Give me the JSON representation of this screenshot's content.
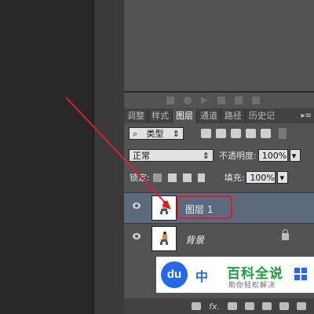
{
  "panel": {
    "tabs": [
      {
        "label": "调整"
      },
      {
        "label": "样式"
      },
      {
        "label": "图层",
        "active": true
      },
      {
        "label": "通道"
      },
      {
        "label": "路径"
      },
      {
        "label": "历史记"
      }
    ],
    "menu_icon": "panel-menu-icon",
    "filter": {
      "search_glyph": "⌕",
      "value": "类型",
      "arrow": "⇕"
    },
    "blend_mode": {
      "value": "正常",
      "arrow": "⇕"
    },
    "opacity": {
      "label": "不透明度:",
      "value": "100%",
      "arrow": "▾"
    },
    "lock": {
      "label": "锁定:"
    },
    "fill": {
      "label": "填充:",
      "value": "100%",
      "arrow": "▾"
    },
    "layers": [
      {
        "name": "图层 1",
        "selected": true
      },
      {
        "name": "背景",
        "locked": true
      }
    ],
    "bottom_fx": "fx."
  },
  "watermark": {
    "logo_text": "du",
    "cn": "中",
    "title": "百科全说",
    "subtitle": "助你轻松解决"
  },
  "colors": {
    "accent_red": "#d9202a",
    "selected_layer": "#5b6a7d",
    "panel_bg": "#535353"
  }
}
